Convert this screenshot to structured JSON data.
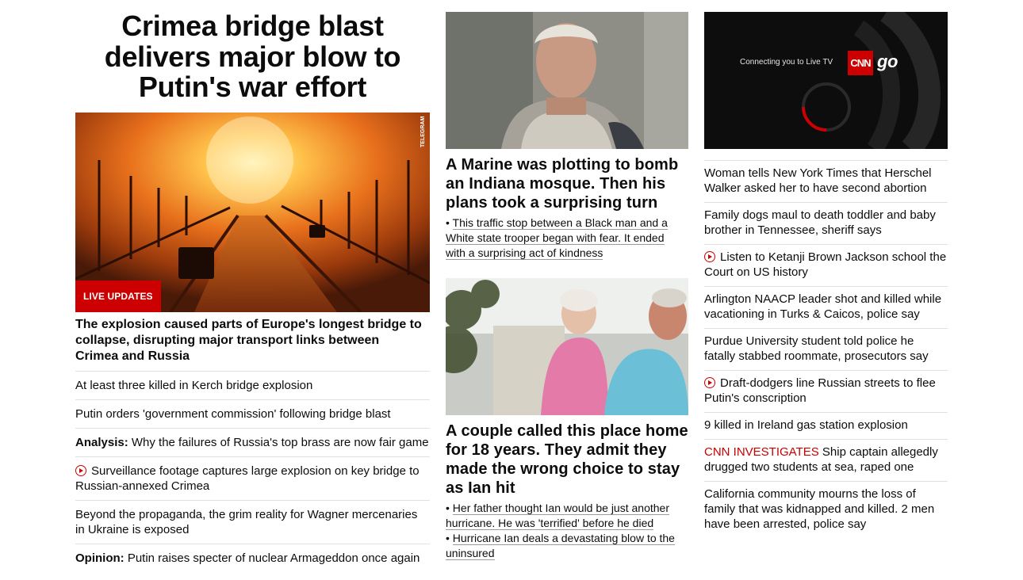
{
  "lead": {
    "headline": "Crimea bridge blast delivers major blow to Putin's war effort",
    "badge": "LIVE UPDATES",
    "image_credit": "TELEGRAM",
    "description": "The explosion caused parts of Europe's longest bridge to collapse, disrupting major transport links between Crimea and Russia",
    "related": [
      {
        "label": "",
        "text": "At least three killed in Kerch bridge explosion",
        "video": false
      },
      {
        "label": "",
        "text": "Putin orders 'government commission' following bridge blast",
        "video": false
      },
      {
        "label": "Analysis:",
        "text": "Why the failures of Russia's top brass are now fair game",
        "video": false
      },
      {
        "label": "",
        "text": "Surveillance footage captures large explosion on key bridge to Russian-annexed Crimea",
        "video": true
      },
      {
        "label": "",
        "text": "Beyond the propaganda, the grim reality for Wagner mercenaries in Ukraine is exposed",
        "video": false
      },
      {
        "label": "Opinion:",
        "text": "Putin raises specter of nuclear Armageddon once again",
        "video": false
      }
    ]
  },
  "middle": {
    "marine": {
      "title": "A Marine was plotting to bomb an Indiana mosque. Then his plans took a surprising turn",
      "bullets": [
        "This traffic stop between a Black man and a White state trooper began with fear. It ended with a surprising act of kindness"
      ]
    },
    "couple": {
      "title": "A couple called this place home for 18 years. They admit they made the wrong choice to stay as Ian hit",
      "bullets": [
        "Her father thought Ian would be just another hurricane. He was 'terrified' before he died",
        "Hurricane Ian deals a devastating blow to the uninsured"
      ]
    }
  },
  "right": {
    "video": {
      "connecting": "Connecting you to Live TV",
      "logo": "CNN",
      "logo_suffix": "go"
    },
    "headlines": [
      {
        "label": "",
        "text": "Woman tells New York Times that Herschel Walker asked her to have second abortion",
        "video": false
      },
      {
        "label": "",
        "text": "Family dogs maul to death toddler and baby brother in Tennessee, sheriff says",
        "video": false
      },
      {
        "label": "",
        "text": "Listen to Ketanji Brown Jackson school the Court on US history",
        "video": true
      },
      {
        "label": "",
        "text": "Arlington NAACP leader shot and killed while vacationing in Turks & Caicos, police say",
        "video": false
      },
      {
        "label": "",
        "text": "Purdue University student told police he fatally stabbed roommate, prosecutors say",
        "video": false
      },
      {
        "label": "",
        "text": "Draft-dodgers line Russian streets to flee Putin's conscription",
        "video": true
      },
      {
        "label": "",
        "text": "9 killed in Ireland gas station explosion",
        "video": false
      },
      {
        "label": "CNN INVESTIGATES",
        "text": "Ship captain allegedly drugged two students at sea, raped one",
        "video": false
      },
      {
        "label": "",
        "text": "California community mourns the loss of family that was kidnapped and killed. 2 men have been arrested, police say",
        "video": false
      }
    ]
  },
  "colors": {
    "accent": "#cc0000",
    "text": "#0c0c0c",
    "divider": "#e0e0e0"
  }
}
